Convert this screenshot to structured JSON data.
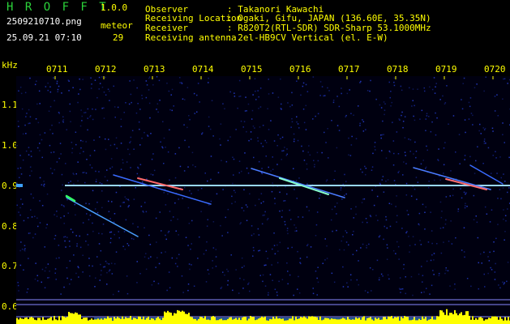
{
  "header": {
    "brand": "H R O F F T",
    "version": "1.0.0",
    "filename": "2509210710.png",
    "datetime": "25.09.21 07:10",
    "meteor_label": "meteor",
    "meteor_count": "29"
  },
  "info": [
    {
      "label": "Observer",
      "value": ": Takanori Kawachi"
    },
    {
      "label": "Receiving Location",
      "value": ": Ogaki, Gifu, JAPAN (136.60E, 35.35N)"
    },
    {
      "label": "Receiver",
      "value": ": R820T2(RTL-SDR) SDR-Sharp 53.1000MHz"
    },
    {
      "label": "Receiving antenna",
      "value": ": 2el-HB9CV Vertical (el. E-W)"
    }
  ],
  "axis": {
    "unit": "kHz",
    "time_ticks": [
      "0711",
      "0712",
      "0713",
      "0714",
      "0715",
      "0716",
      "0717",
      "0718",
      "0719",
      "0720"
    ],
    "freq_ticks": [
      "1.1",
      "1.0",
      "0.9",
      "0.8",
      "0.7",
      "0.6"
    ]
  },
  "colors": {
    "label": "#ffff00",
    "brand": "#2bd23a",
    "text": "#ffffff",
    "carrier": "#9ad8ff",
    "noise": "#1a2f8a"
  }
}
